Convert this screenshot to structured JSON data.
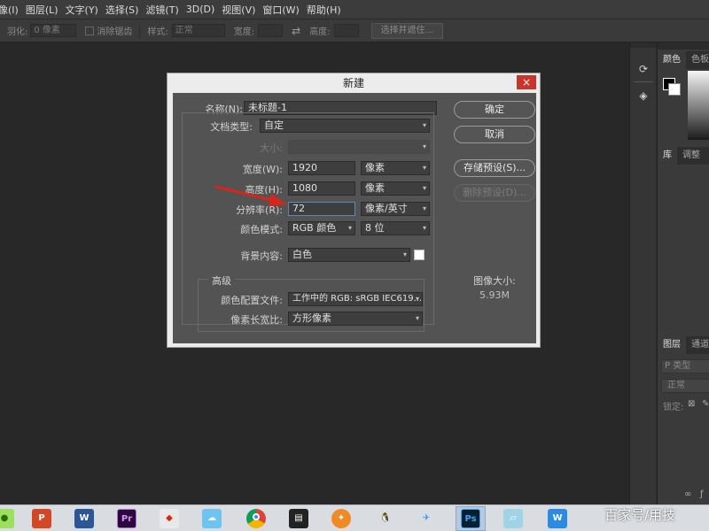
{
  "menubar": {
    "items": [
      "像(I)",
      "图层(L)",
      "文字(Y)",
      "选择(S)",
      "滤镜(T)",
      "3D(D)",
      "视图(V)",
      "窗口(W)",
      "帮助(H)"
    ]
  },
  "options_bar": {
    "feather_label": "羽化:",
    "feather_value": "0 像素",
    "antialias_label": "消除锯齿",
    "style_label": "样式:",
    "style_value": "正常",
    "width_label": "宽度:",
    "height_label": "高度:",
    "select_mask_button": "选择并遮住..."
  },
  "right_panels": {
    "top_tabs": [
      "颜色",
      "色板"
    ],
    "mid_tabs": [
      "库",
      "调整"
    ],
    "layer_tabs": [
      "图层",
      "通道"
    ],
    "layer_search_placeholder": "P 类型",
    "blend_mode": "正常",
    "lock_label": "锁定:"
  },
  "dialog": {
    "title": "新建",
    "close_icon": "×",
    "name_label": "名称(N):",
    "name_value": "未标题-1",
    "doc_type_label": "文档类型:",
    "doc_type_value": "自定",
    "size_label": "大小:",
    "width_label": "宽度(W):",
    "width_value": "1920",
    "width_unit": "像素",
    "height_label": "高度(H):",
    "height_value": "1080",
    "height_unit": "像素",
    "resolution_label": "分辨率(R):",
    "resolution_value": "72",
    "resolution_unit": "像素/英寸",
    "color_mode_label": "颜色模式:",
    "color_mode_value": "RGB 颜色",
    "bit_depth_value": "8 位",
    "bg_label": "背景内容:",
    "bg_value": "白色",
    "advanced_label": "高级",
    "color_profile_label": "颜色配置文件:",
    "color_profile_value": "工作中的 RGB: sRGB IEC619...",
    "pixel_aspect_label": "像素长宽比:",
    "pixel_aspect_value": "方形像素",
    "ok_button": "确定",
    "cancel_button": "取消",
    "save_preset_button": "存储预设(S)...",
    "delete_preset_button": "删除预设(D)...",
    "image_size_label": "图像大小:",
    "image_size_value": "5.93M"
  },
  "taskbar": {
    "icons": [
      "wechat-icon",
      "powerpoint-icon",
      "word-icon",
      "premiere-icon",
      "app-icon",
      "app-icon",
      "chrome-icon",
      "video-editor-icon",
      "app-icon",
      "qq-icon",
      "app-icon",
      "photoshop-icon",
      "app-icon",
      "wps-icon"
    ],
    "ps_label": "Ps",
    "pr_label": "Pr"
  },
  "watermark": "百家号/用技"
}
